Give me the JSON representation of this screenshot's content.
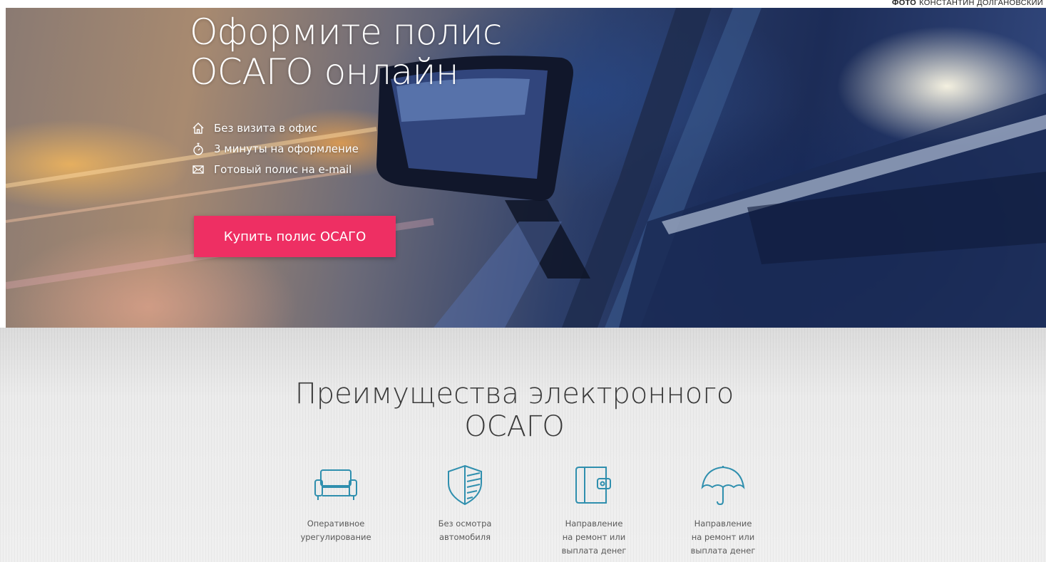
{
  "photo_credit": {
    "prefix": "ФОТО",
    "name": "КОНСТАНТИН ДОЛГАНОВСКИЙ"
  },
  "hero": {
    "title_line1": "Оформите полис",
    "title_line2": "ОСАГО онлайн",
    "features": [
      {
        "icon": "house-icon",
        "text": "Без визита в офис"
      },
      {
        "icon": "stopwatch-icon",
        "text": "3 минуты на оформление"
      },
      {
        "icon": "envelope-icon",
        "text": "Готовый полис на e-mail"
      }
    ],
    "buy_button": "Купить полис ОСАГО"
  },
  "advantages": {
    "title_line1": "Преимущества электронного",
    "title_line2": "ОСАГО",
    "items": [
      {
        "icon": "sofa-icon",
        "label": "Оперативное\nурегулирование"
      },
      {
        "icon": "shield-icon",
        "label": "Без осмотра\nавтомобиля"
      },
      {
        "icon": "wallet-icon",
        "label": "Направление\nна ремонт или\nвыплата денег"
      },
      {
        "icon": "umbrella-icon",
        "label": "Направление\nна ремонт или\nвыплата денег"
      }
    ]
  },
  "colors": {
    "accent": "#ee2f63",
    "icon_stroke": "#2f8fae"
  }
}
